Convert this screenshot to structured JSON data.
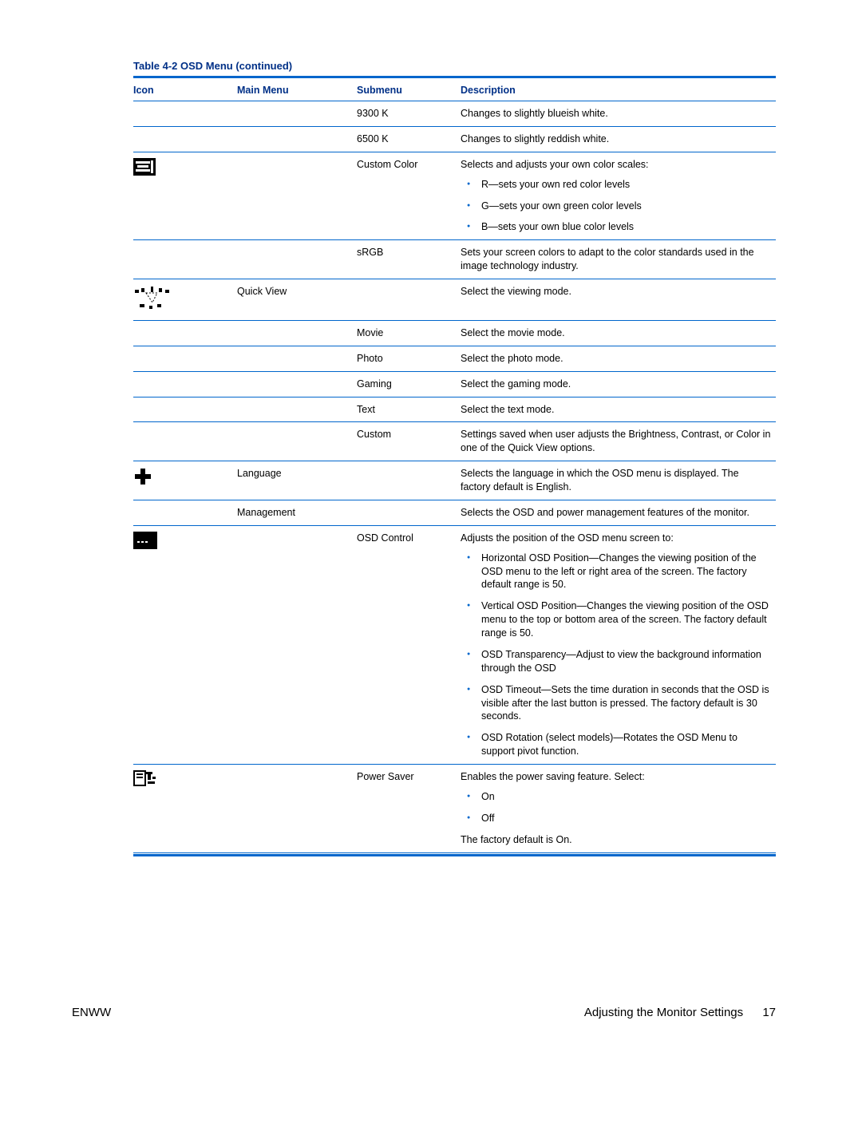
{
  "table_title": "Table 4-2  OSD Menu (continued)",
  "headers": {
    "icon": "Icon",
    "main": "Main Menu",
    "sub": "Submenu",
    "desc": "Description"
  },
  "rows": [
    {
      "icon": null,
      "main": "",
      "sub": "9300 K",
      "desc": "Changes to slightly blueish white.",
      "border": true
    },
    {
      "icon": null,
      "main": "",
      "sub": "6500 K",
      "desc": "Changes to slightly reddish white.",
      "border": true
    },
    {
      "icon": "color-sliders-icon",
      "main": "",
      "sub": "Custom Color",
      "desc": "Selects and adjusts your own color scales:",
      "bullets": [
        "R—sets your own red color levels",
        "G—sets your own green color levels",
        "B—sets your own blue color levels"
      ],
      "border": true
    },
    {
      "icon": null,
      "main": "",
      "sub": "sRGB",
      "desc": "Sets your screen colors to adapt to the color standards used in the image technology industry.",
      "border": true
    },
    {
      "icon": "quickview-icon",
      "main": "Quick View",
      "sub": "",
      "desc": "Select the viewing mode.",
      "border": true,
      "tall_icon": true
    },
    {
      "icon": null,
      "main": "",
      "sub": "Movie",
      "desc": "Select the movie mode.",
      "border": true
    },
    {
      "icon": null,
      "main": "",
      "sub": "Photo",
      "desc": "Select the photo mode.",
      "border": true
    },
    {
      "icon": null,
      "main": "",
      "sub": "Gaming",
      "desc": "Select the gaming mode.",
      "border": true
    },
    {
      "icon": null,
      "main": "",
      "sub": "Text",
      "desc": "Select the text mode.",
      "border": true
    },
    {
      "icon": null,
      "main": "",
      "sub": "Custom",
      "desc": "Settings saved when user adjusts the Brightness, Contrast, or Color in one of the Quick View options.",
      "border": true
    },
    {
      "icon": "plus-icon",
      "main": "Language",
      "sub": "",
      "desc": "Selects the language in which the OSD menu is displayed. The factory default is English.",
      "border": true
    },
    {
      "icon": null,
      "main": "Management",
      "sub": "",
      "desc": "Selects the OSD and power management features of the monitor.",
      "border": true
    },
    {
      "icon": "osd-control-icon",
      "main": "",
      "sub": "OSD Control",
      "desc": "Adjusts the position of the OSD menu screen to:",
      "bullets": [
        "Horizontal OSD Position—Changes the viewing position of the OSD menu to the left or right area of the screen. The factory default range is 50.",
        "Vertical OSD Position—Changes the viewing position of the OSD menu to the top or bottom area of the screen. The factory default range is 50.",
        "OSD Transparency—Adjust to view the background information through the OSD",
        "OSD Timeout—Sets the time duration in seconds that the OSD is visible after the last button is pressed. The factory default is 30 seconds.",
        "OSD Rotation (select models)—Rotates the OSD Menu to support pivot function."
      ],
      "border": true
    },
    {
      "icon": "power-saver-icon",
      "main": "",
      "sub": "Power Saver",
      "desc": "Enables the power saving feature. Select:",
      "bullets": [
        "On",
        "Off"
      ],
      "trailing": "The factory default is On.",
      "border": false
    }
  ],
  "footer": {
    "left": "ENWW",
    "right": "Adjusting the Monitor Settings",
    "page": "17"
  }
}
